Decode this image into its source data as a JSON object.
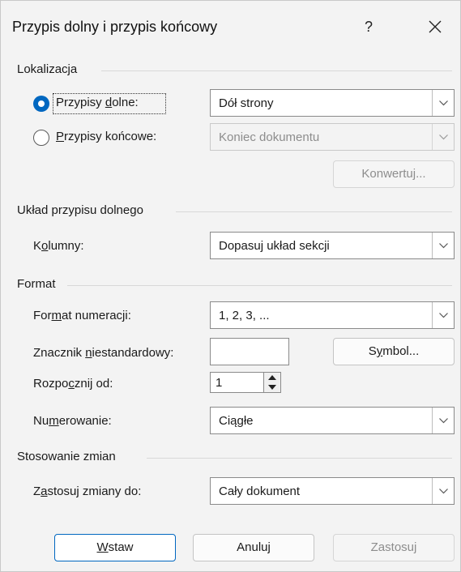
{
  "title": "Przypis dolny i przypis końcowy",
  "help_label": "?",
  "sections": {
    "location": "Lokalizacja",
    "layout": "Układ przypisu dolnego",
    "format": "Format",
    "apply": "Stosowanie zmian"
  },
  "location": {
    "footnotes": {
      "label_pre": "Przypisy ",
      "label_key": "d",
      "label_post": "olne:",
      "selected": true,
      "value": "Dół strony"
    },
    "endnotes": {
      "label_pre": "",
      "label_key": "P",
      "label_post": "rzypisy końcowe:",
      "selected": false,
      "value": "Koniec dokumentu"
    },
    "convert_label": "Konwertuj..."
  },
  "layout": {
    "columns": {
      "label_pre": "K",
      "label_key": "o",
      "label_post": "lumny:",
      "value": "Dopasuj układ sekcji"
    }
  },
  "format": {
    "number_format": {
      "label_pre": "For",
      "label_key": "m",
      "label_post": "at numeracji:",
      "value": "1, 2, 3, ..."
    },
    "custom_mark": {
      "label_pre": "Znacznik ",
      "label_key": "n",
      "label_post": "iestandardowy:",
      "value": ""
    },
    "symbol_btn": {
      "pre": "S",
      "key": "y",
      "post": "mbol..."
    },
    "start_at": {
      "label_pre": "Rozpo",
      "label_key": "c",
      "label_post": "znij od:",
      "value": "1"
    },
    "numbering": {
      "label_pre": "Nu",
      "label_key": "m",
      "label_post": "erowanie:",
      "value": "Ciągłe"
    }
  },
  "apply": {
    "apply_to": {
      "label_pre": "Z",
      "label_key": "a",
      "label_post": "stosuj zmiany do:",
      "value": "Cały dokument"
    }
  },
  "buttons": {
    "insert": {
      "pre": "",
      "key": "W",
      "post": "staw"
    },
    "cancel": "Anuluj",
    "apply": "Zastosuj"
  },
  "colors": {
    "accent": "#0067c0",
    "background": "#f3f3f3"
  }
}
